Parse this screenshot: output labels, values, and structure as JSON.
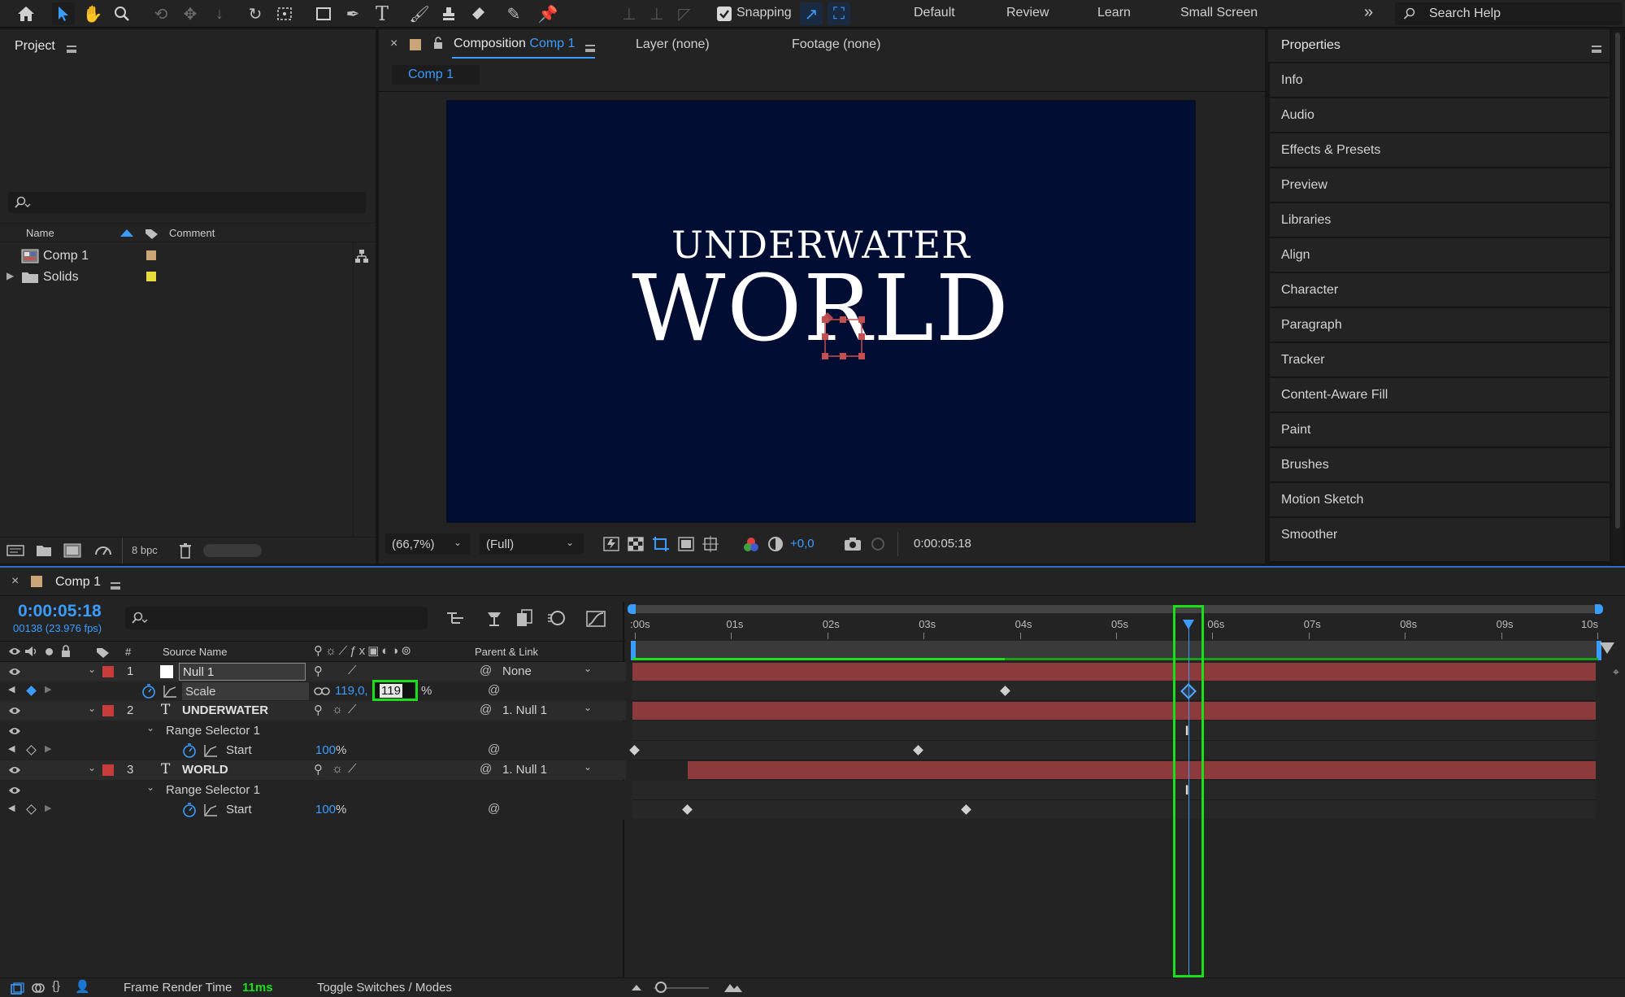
{
  "toolbar": {
    "snapping_label": "Snapping",
    "workspaces": [
      "Default",
      "Review",
      "Learn",
      "Small Screen"
    ],
    "search_placeholder": "Search Help"
  },
  "project": {
    "title": "Project",
    "columns": {
      "name": "Name",
      "comment": "Comment"
    },
    "items": [
      {
        "name": "Comp 1",
        "type": "composition",
        "label_color": "#c9a577"
      },
      {
        "name": "Solids",
        "type": "folder",
        "label_color": "#e8dc3c"
      }
    ],
    "bpc_label": "8 bpc"
  },
  "composition": {
    "tab_prefix": "Composition",
    "tab_name": "Comp 1",
    "layer_tab": "Layer (none)",
    "footage_tab": "Footage (none)",
    "breadcrumb": "Comp 1",
    "canvas_color": "#020d33",
    "title_line1": "UNDERWATER",
    "title_line2": "WORLD",
    "zoom": "(66,7%)",
    "resolution": "(Full)",
    "exposure": "+0,0",
    "timecode": "0:00:05:18"
  },
  "properties": {
    "title": "Properties",
    "items": [
      "Info",
      "Audio",
      "Effects & Presets",
      "Preview",
      "Libraries",
      "Align",
      "Character",
      "Paragraph",
      "Tracker",
      "Content-Aware Fill",
      "Paint",
      "Brushes",
      "Motion Sketch",
      "Smoother"
    ]
  },
  "timeline": {
    "comp_tab": "Comp 1",
    "timecode": "0:00:05:18",
    "frame_info": "00138 (23.976 fps)",
    "columns": {
      "hash": "#",
      "source_name": "Source Name",
      "parent": "Parent & Link"
    },
    "layers": [
      {
        "num": "1",
        "name": "Null 1",
        "parent": "None",
        "label_color": "#c83c3c"
      },
      {
        "num": "2",
        "name": "UNDERWATER",
        "parent": "1. Null 1",
        "label_color": "#c83c3c"
      },
      {
        "num": "3",
        "name": "WORLD",
        "parent": "1. Null 1",
        "label_color": "#c83c3c"
      }
    ],
    "scale": {
      "label": "Scale",
      "value": "119,0,",
      "editing": "119",
      "unit": "%"
    },
    "range_selector_label": "Range Selector 1",
    "start_label": "Start",
    "start_value": "100",
    "percent": "%",
    "ruler_ticks": [
      ":00s",
      "01s",
      "02s",
      "03s",
      "04s",
      "05s",
      "06s",
      "07s",
      "08s",
      "09s",
      "10s"
    ],
    "playhead_seconds": 5.75,
    "layer3_start_seconds": 0.55,
    "keyframes": {
      "scale": [
        3.85,
        5.75
      ],
      "underwater_start": [
        0.0,
        2.95
      ],
      "world_start": [
        0.55,
        3.45
      ]
    },
    "footer": {
      "frame_render_label": "Frame Render Time",
      "frame_render_value": "11ms",
      "toggle_label": "Toggle Switches / Modes"
    }
  }
}
